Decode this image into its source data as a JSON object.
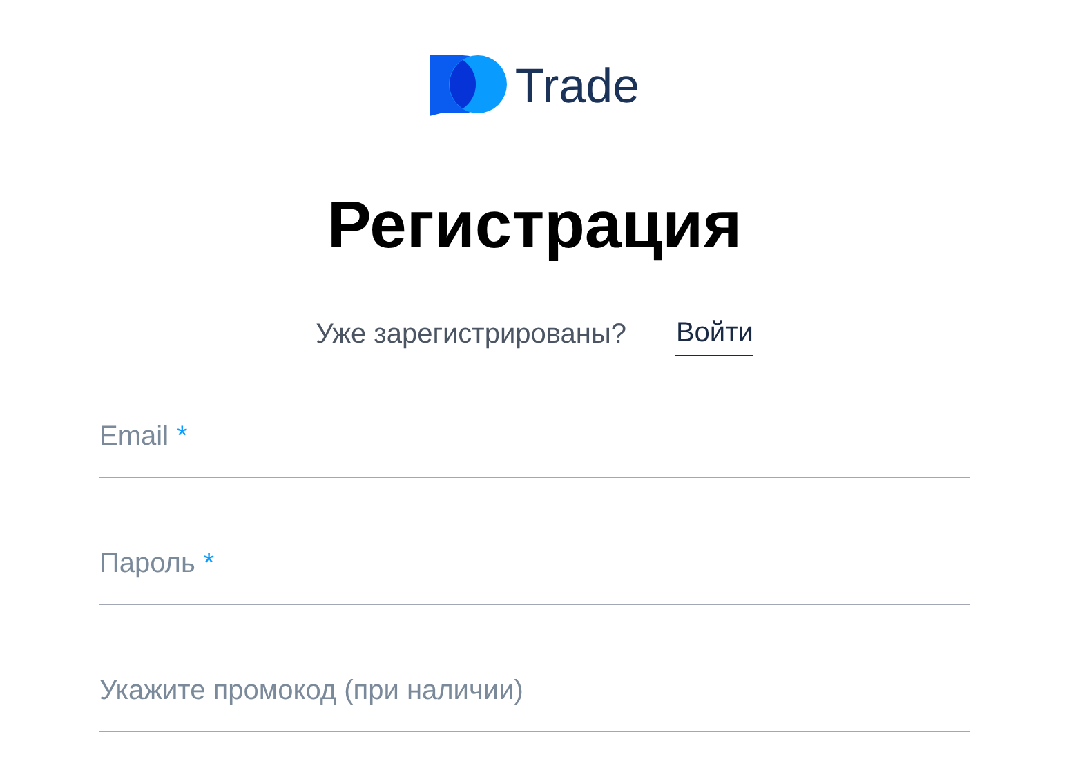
{
  "logo": {
    "text": "Trade"
  },
  "title": "Регистрация",
  "login_prompt": {
    "text": "Уже зарегистрированы?",
    "link": "Войти"
  },
  "fields": [
    {
      "label": "Email",
      "marker": "*"
    },
    {
      "label": "Пароль",
      "marker": "*"
    },
    {
      "label": "Укажите промокод (при наличии)"
    }
  ]
}
